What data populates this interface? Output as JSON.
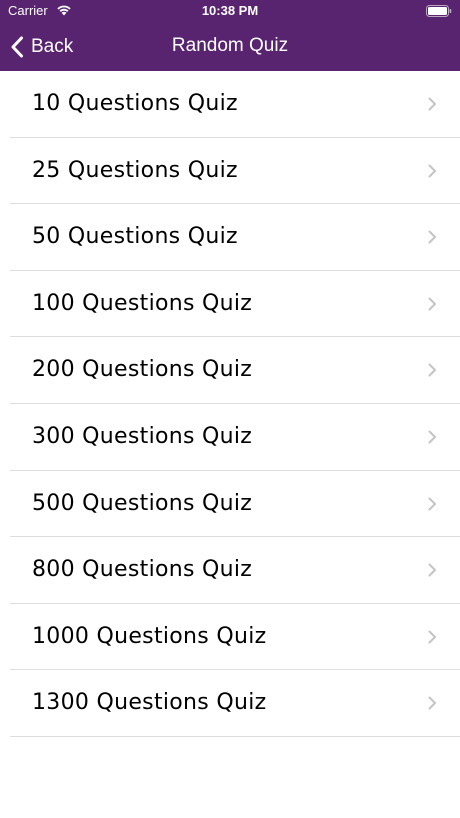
{
  "status_bar": {
    "carrier": "Carrier",
    "time": "10:38 PM"
  },
  "nav": {
    "back_label": "Back",
    "title": "Random Quiz"
  },
  "quiz_options": [
    {
      "label": "10 Questions Quiz"
    },
    {
      "label": "25 Questions Quiz"
    },
    {
      "label": "50 Questions Quiz"
    },
    {
      "label": "100 Questions Quiz"
    },
    {
      "label": "200 Questions Quiz"
    },
    {
      "label": "300 Questions Quiz"
    },
    {
      "label": "500 Questions Quiz"
    },
    {
      "label": "800 Questions Quiz"
    },
    {
      "label": "1000 Questions Quiz"
    },
    {
      "label": "1300 Questions Quiz"
    }
  ],
  "colors": {
    "header_background": "#59246f",
    "header_text": "#ffffff",
    "list_text": "#000000",
    "separator": "#dedede",
    "chevron": "#c4c4c7"
  }
}
